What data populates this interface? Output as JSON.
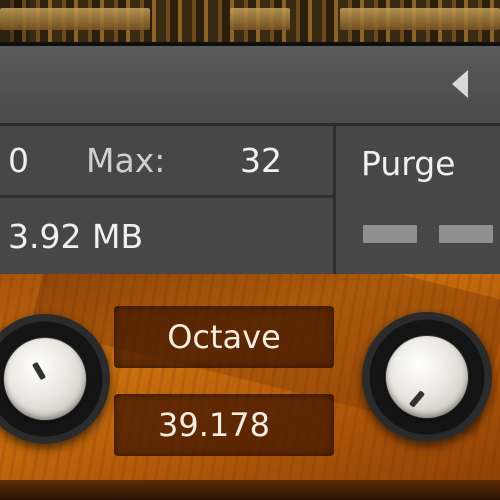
{
  "memory_panel": {
    "voices_value": "0",
    "max_label": "Max:",
    "max_value": "32",
    "memory_value": "3.92 MB",
    "purge_label": "Purge"
  },
  "instrument": {
    "parameter_label": "Octave",
    "parameter_value": "39.178"
  },
  "icons": {
    "collapse": "triangle-left-icon",
    "knobs": "rotary-knob-icon"
  },
  "colors": {
    "panel_gray": "#474747",
    "wood_orange": "#c9700f",
    "display_brown": "#46190a",
    "text_light": "#f0f0f0"
  }
}
